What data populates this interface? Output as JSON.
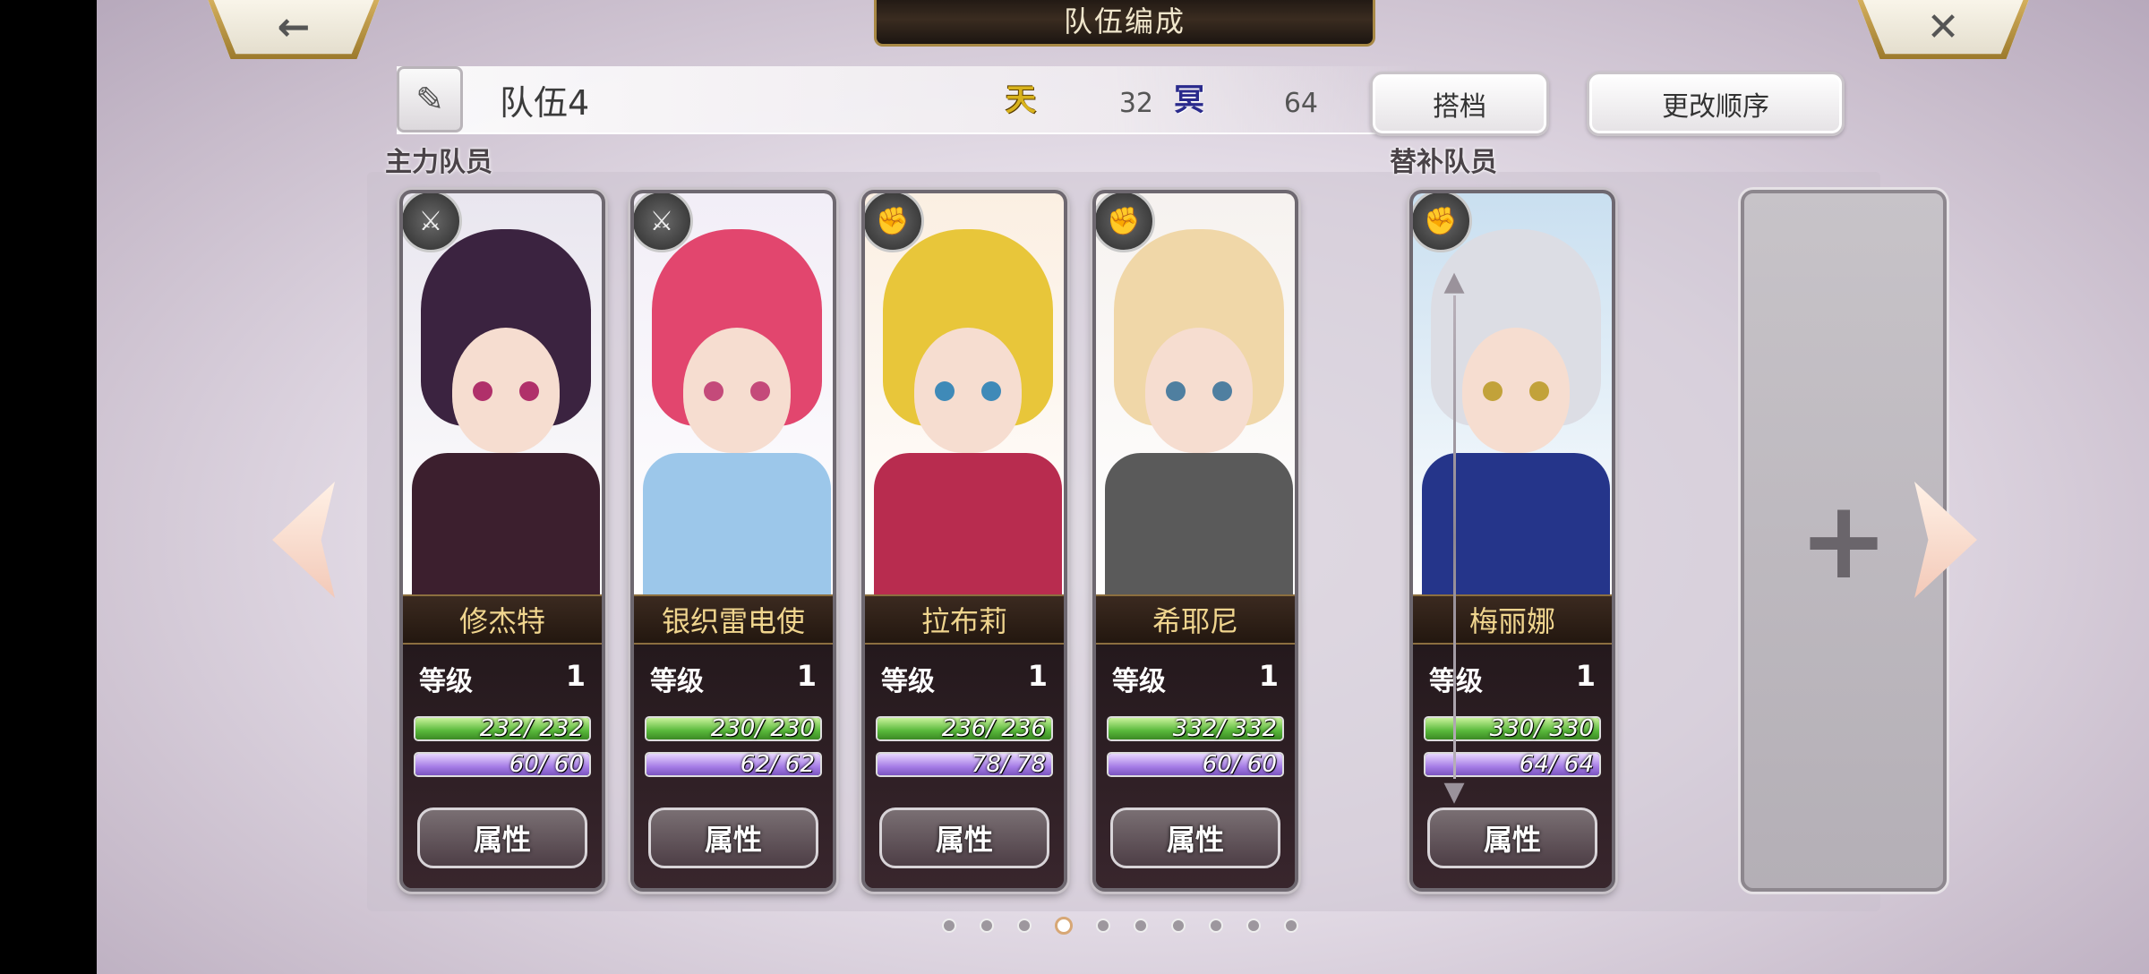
{
  "header": {
    "title": "队伍编成",
    "back_icon": "←",
    "close_icon": "✕"
  },
  "team": {
    "edit_icon": "✎",
    "name": "队伍4",
    "sky_icon": "天",
    "sky_value": "32",
    "hell_icon": "冥",
    "hell_value": "64",
    "partner_label": "搭档",
    "order_label": "更改顺序"
  },
  "sections": {
    "main_label": "主力队员",
    "sub_label": "替补队员"
  },
  "level_label": "等级",
  "attr_label": "属性",
  "characters": [
    {
      "name": "修杰特",
      "level": "1",
      "hp": "232/ 232",
      "hp_frac": 1.0,
      "mp": "60/ 60",
      "mp_frac": 1.0,
      "class_icon": "⚔",
      "hair": "#3b2340",
      "eyes": "#b0306a",
      "outfit": "#3c1f2e",
      "bg": "#e9e6ef"
    },
    {
      "name": "银织雷电使",
      "level": "1",
      "hp": "230/ 230",
      "hp_frac": 1.0,
      "mp": "62/ 62",
      "mp_frac": 1.0,
      "class_icon": "⚔",
      "hair": "#e2466e",
      "eyes": "#c44a7a",
      "outfit": "#9cc7ea",
      "bg": "#f2eef7"
    },
    {
      "name": "拉布莉",
      "level": "1",
      "hp": "236/ 236",
      "hp_frac": 1.0,
      "mp": "78/ 78",
      "mp_frac": 1.0,
      "class_icon": "✊",
      "hair": "#e8c63a",
      "eyes": "#3f8ab8",
      "outfit": "#b82c4f",
      "bg": "#fbefe2"
    },
    {
      "name": "希耶尼",
      "level": "1",
      "hp": "332/ 332",
      "hp_frac": 1.0,
      "mp": "60/ 60",
      "mp_frac": 1.0,
      "class_icon": "✊",
      "hair": "#f0d7a8",
      "eyes": "#4f7fa0",
      "outfit": "#5a5a5a",
      "bg": "#f6f2ef"
    },
    {
      "name": "梅丽娜",
      "level": "1",
      "hp": "330/ 330",
      "hp_frac": 1.0,
      "mp": "64/ 64",
      "mp_frac": 1.0,
      "class_icon": "✊",
      "hair": "#dcdde4",
      "eyes": "#c2a23a",
      "outfit": "#25358a",
      "bg": "#c9dff0"
    }
  ],
  "empty_slot_icon": "+",
  "pagination": {
    "total": 10,
    "active_index": 3
  },
  "colors": {
    "hp": "#58b83a",
    "mp": "#a67de6",
    "name_text": "#f0d58e",
    "accent_gold": "#a88945"
  }
}
